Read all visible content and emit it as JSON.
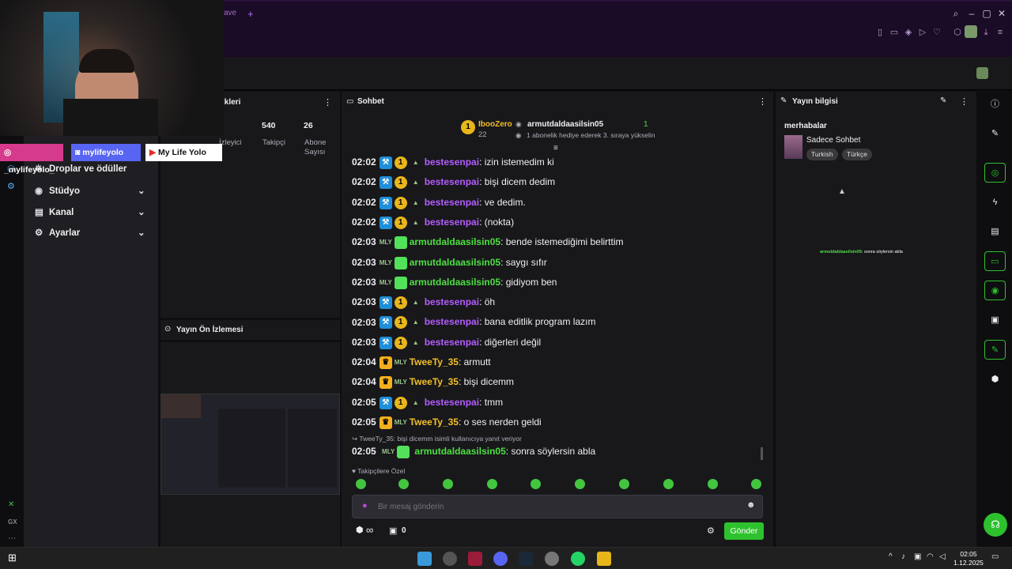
{
  "browser": {
    "tab_fragment": "ave",
    "new_tab": "+"
  },
  "sidebar_nav": {
    "items": [
      {
        "label": "Droplar ve ödüller",
        "icon": "drops-icon"
      },
      {
        "label": "Stüdyo",
        "icon": "studio-icon"
      },
      {
        "label": "Kanal",
        "icon": "channel-icon"
      },
      {
        "label": "Ayarlar",
        "icon": "gear-icon"
      }
    ],
    "gx_label": "GX"
  },
  "stats_panel": {
    "title_fragment": "ikleri",
    "stats": [
      {
        "value": "",
        "label": "İzleyici"
      },
      {
        "value": "540",
        "label": "Takipçi"
      },
      {
        "value": "26",
        "label": "Abone Sayısı"
      }
    ]
  },
  "preview_panel": {
    "title": "Yayın Ön İzlemesi"
  },
  "overlay_socials": [
    {
      "label": "_mylifeyolo_",
      "network": "instagram"
    },
    {
      "label": "mylifeyolo",
      "network": "discord"
    },
    {
      "label": "My Life Yolo",
      "network": "youtube"
    }
  ],
  "chat": {
    "title": "Sohbet",
    "pinned": {
      "gifter_name": "IbooZero",
      "gifter_count": "22",
      "gifter_rank": "1",
      "user": "armutdaldaasilsin05",
      "user_count": "1",
      "subtitle": "1 abonelik hediye ederek 3. sıraya yükselin"
    },
    "messages": [
      {
        "time": "02:02",
        "user": "bestesenpai",
        "text": ": izin istemedim ki",
        "style": "purple"
      },
      {
        "time": "02:02",
        "user": "bestesenpai",
        "text": ": bişi dicem dedim",
        "style": "purple"
      },
      {
        "time": "02:02",
        "user": "bestesenpai",
        "text": ": ve dedim.",
        "style": "purple"
      },
      {
        "time": "02:02",
        "user": "bestesenpai",
        "text": ": (nokta)",
        "style": "purple"
      },
      {
        "time": "02:03",
        "user": "armutdaldaasilsin05",
        "text": ": bende istemediğimi belirttim",
        "style": "green"
      },
      {
        "time": "02:03",
        "user": "armutdaldaasilsin05",
        "text": ": saygı sıfır",
        "style": "green"
      },
      {
        "time": "02:03",
        "user": "armutdaldaasilsin05",
        "text": ": gidiyom ben",
        "style": "green"
      },
      {
        "time": "02:03",
        "user": "bestesenpai",
        "text": ": öh",
        "style": "purple"
      },
      {
        "time": "02:03",
        "user": "bestesenpai",
        "text": ": bana editlik program lazım",
        "style": "purple"
      },
      {
        "time": "02:03",
        "user": "bestesenpai",
        "text": ": diğerleri değil",
        "style": "purple"
      },
      {
        "time": "02:04",
        "user": "TweeTy_35",
        "text": ": armutt",
        "style": "yellow"
      },
      {
        "time": "02:04",
        "user": "TweeTy_35",
        "text": ": bişi dicemm",
        "style": "yellow"
      },
      {
        "time": "02:05",
        "user": "bestesenpai",
        "text": ": tmm",
        "style": "purple"
      },
      {
        "time": "02:05",
        "user": "TweeTy_35",
        "text": ": o ses nerden geldi",
        "style": "yellow"
      }
    ],
    "reply_note": "TweeTy_35: bişi dicemm isimli kullanıcıya yanıt veriyor",
    "last_message": {
      "time": "02:05",
      "user": "armutdaldaasilsin05",
      "text": ": sonra söylersin abla"
    },
    "emote_section": "Takipçilere Özel",
    "input_placeholder": "Bir mesaj gönderin",
    "points": "∞",
    "gift_count": "0",
    "send_label": "Gönder"
  },
  "stream_info": {
    "title": "Yayın bilgisi",
    "stream_title": "merhabalar",
    "category": "Sadece Sohbet",
    "tags": [
      "Turkish",
      "Türkçe"
    ],
    "overlay_message_user": "armutdaldaasilsin05",
    "overlay_message_text": ": sonra söylersin abla"
  },
  "taskbar": {
    "time": "02:05",
    "date": "1.12.2025"
  },
  "colors": {
    "accent_green": "#2ec12e",
    "chat_purple": "#b45cff",
    "chat_green": "#4ee042",
    "chat_yellow": "#f2c029"
  }
}
